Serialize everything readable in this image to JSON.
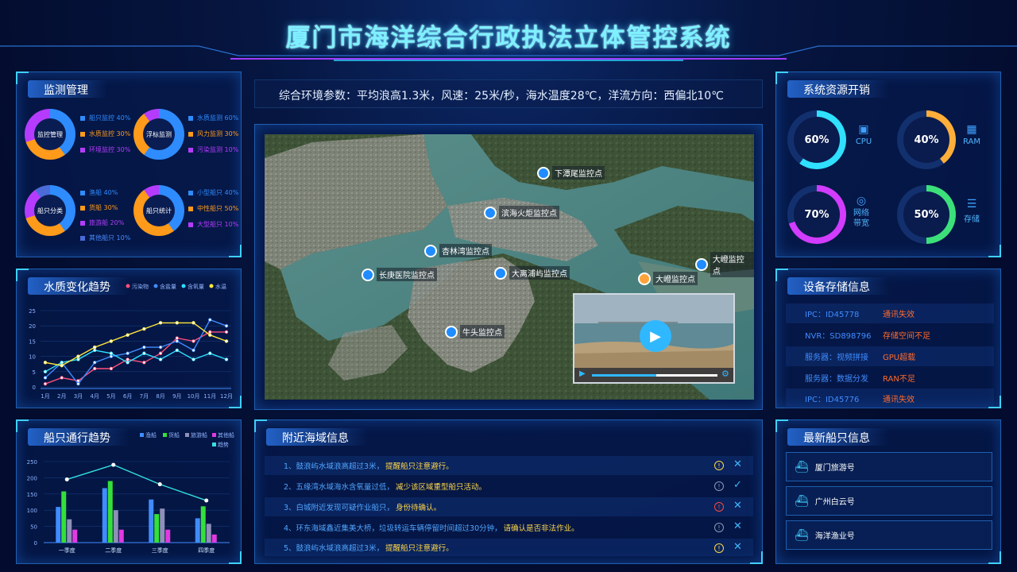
{
  "header": {
    "title": "厦门市海洋综合行政执法立体管控系统"
  },
  "monitor": {
    "title": "监测管理",
    "donuts": [
      {
        "label": "监控管理",
        "legend": [
          {
            "text": "船只监控",
            "pct": "40%",
            "color": "#2f8cff"
          },
          {
            "text": "水质监控",
            "pct": "30%",
            "color": "#ff9a1a"
          },
          {
            "text": "环境监控",
            "pct": "30%",
            "color": "#b53cff"
          }
        ]
      },
      {
        "label": "浮标监测",
        "legend": [
          {
            "text": "水质监测",
            "pct": "60%",
            "color": "#2f8cff"
          },
          {
            "text": "风力监测",
            "pct": "30%",
            "color": "#ff9a1a"
          },
          {
            "text": "污染监测",
            "pct": "10%",
            "color": "#b53cff"
          }
        ]
      },
      {
        "label": "船只分类",
        "legend": [
          {
            "text": "渔船",
            "pct": "40%",
            "color": "#2f8cff"
          },
          {
            "text": "货船",
            "pct": "30%",
            "color": "#ff9a1a"
          },
          {
            "text": "旅游船",
            "pct": "20%",
            "color": "#b53cff"
          },
          {
            "text": "其他船只",
            "pct": "10%",
            "color": "#4a6bd8"
          }
        ]
      },
      {
        "label": "船只统计",
        "legend": [
          {
            "text": "小型船只",
            "pct": "40%",
            "color": "#2f8cff"
          },
          {
            "text": "中性船只",
            "pct": "50%",
            "color": "#ff9a1a"
          },
          {
            "text": "大型船只",
            "pct": "10%",
            "color": "#b53cff"
          }
        ]
      }
    ]
  },
  "water": {
    "title": "水质变化趋势",
    "legend": [
      "污染物",
      "含盐量",
      "含氧量",
      "水温"
    ]
  },
  "ships_trend": {
    "title": "船只通行趋势",
    "legend": [
      "渔船",
      "货船",
      "旅游船",
      "其他船",
      "趋势"
    ]
  },
  "env": {
    "text": "综合环境参数：平均浪高1.3米，风速：25米/秒，海水温度28℃，洋流方向：西偏北10℃"
  },
  "map": {
    "markers": [
      {
        "name": "下潭尾监控点"
      },
      {
        "name": "滨海火炬监控点"
      },
      {
        "name": "杏林湾监控点"
      },
      {
        "name": "长庚医院监控点"
      },
      {
        "name": "大离浦屿监控点"
      },
      {
        "name": "大嶝监控点"
      },
      {
        "name": "大嶝监控点"
      },
      {
        "name": "牛头监控点"
      }
    ]
  },
  "sysres": {
    "title": "系统资源开销",
    "items": [
      {
        "value": "60%",
        "label": "CPU",
        "pct": 0.6,
        "color": "#2fe0ff"
      },
      {
        "value": "40%",
        "label": "RAM",
        "pct": 0.4,
        "color": "#ffae3a"
      },
      {
        "value": "70%",
        "label": "网络带宽",
        "pct": 0.7,
        "color": "#d23cff"
      },
      {
        "value": "50%",
        "label": "存储",
        "pct": 0.5,
        "color": "#3ce07a"
      }
    ]
  },
  "device": {
    "title": "设备存储信息",
    "rows": [
      {
        "a": "IPC：ID45778",
        "b": "通讯失效"
      },
      {
        "a": "NVR：SD898796",
        "b": "存储空间不足"
      },
      {
        "a": "服务器：视频拼接",
        "b": "GPU超载"
      },
      {
        "a": "服务器：数据分发",
        "b": "RAN不足"
      },
      {
        "a": "IPC：ID45776",
        "b": "通讯失效"
      }
    ]
  },
  "sea": {
    "title": "附近海域信息",
    "rows": [
      {
        "t": "1、鼓浪屿水域浪高超过3米，",
        "h": "提醒船只注意避行。",
        "s": "!",
        "sc": "#ffd84a",
        "x": "✕"
      },
      {
        "t": "2、五缘湾水域海水含氧量过低，",
        "h": "减少该区域重型船只活动。",
        "s": "!",
        "sc": "#8a9ab8",
        "x": "✓"
      },
      {
        "t": "3、白城附近发现可疑作业船只，",
        "h": "身份待确认。",
        "s": "!",
        "sc": "#ff4a3a",
        "x": "✕"
      },
      {
        "t": "4、环东海域鑫近集美大桥，垃圾转运车辆停留时间超过30分钟，",
        "h": "请确认是否非法作业。",
        "s": "!",
        "sc": "#8a9ab8",
        "x": "✕"
      },
      {
        "t": "5、鼓浪屿水域浪高超过3米，",
        "h": "提醒船只注意避行。",
        "s": "!",
        "sc": "#ffd84a",
        "x": "✕"
      }
    ]
  },
  "latest": {
    "title": "最新船只信息",
    "ships": [
      "厦门旅游号",
      "广州白云号",
      "海洋渔业号"
    ]
  },
  "chart_data": [
    {
      "type": "line",
      "title": "水质变化趋势",
      "categories": [
        "1月",
        "2月",
        "3月",
        "4月",
        "5月",
        "6月",
        "7月",
        "8月",
        "9月",
        "10月",
        "11月",
        "12月"
      ],
      "ylim": [
        0,
        25
      ],
      "yticks": [
        0,
        5,
        10,
        15,
        20,
        25
      ],
      "series": [
        {
          "name": "污染物",
          "color": "#ff4f7a",
          "values": [
            1,
            3,
            2,
            6,
            6,
            9,
            8,
            11,
            16,
            15,
            18,
            18
          ]
        },
        {
          "name": "含盐量",
          "color": "#3f8cff",
          "values": [
            3,
            8,
            1,
            8,
            10,
            11,
            13,
            13,
            15,
            12,
            22,
            20
          ]
        },
        {
          "name": "含氧量",
          "color": "#2fe0ff",
          "values": [
            5,
            8,
            9,
            12,
            11,
            8,
            11,
            9,
            12,
            9,
            11,
            9
          ]
        },
        {
          "name": "水温",
          "color": "#ffe83a",
          "values": [
            8,
            7,
            10,
            13,
            15,
            17,
            19,
            21,
            21,
            21,
            17,
            15
          ]
        }
      ]
    },
    {
      "type": "bar",
      "title": "船只通行趋势",
      "categories": [
        "一季度",
        "二季度",
        "三季度",
        "四季度"
      ],
      "ylim": [
        0,
        250
      ],
      "yticks": [
        0,
        50,
        100,
        150,
        200,
        250
      ],
      "series": [
        {
          "name": "渔船",
          "color": "#3f8cff",
          "values": [
            110,
            168,
            133,
            75
          ]
        },
        {
          "name": "货船",
          "color": "#34e03a",
          "values": [
            158,
            190,
            88,
            112
          ]
        },
        {
          "name": "旅游船",
          "color": "#8f8fb8",
          "values": [
            72,
            100,
            105,
            58
          ]
        },
        {
          "name": "其他船",
          "color": "#e03ae0",
          "values": [
            40,
            40,
            40,
            25
          ]
        }
      ],
      "trend": {
        "name": "趋势",
        "color": "#34e0e0",
        "values": [
          195,
          240,
          180,
          130
        ]
      }
    }
  ]
}
